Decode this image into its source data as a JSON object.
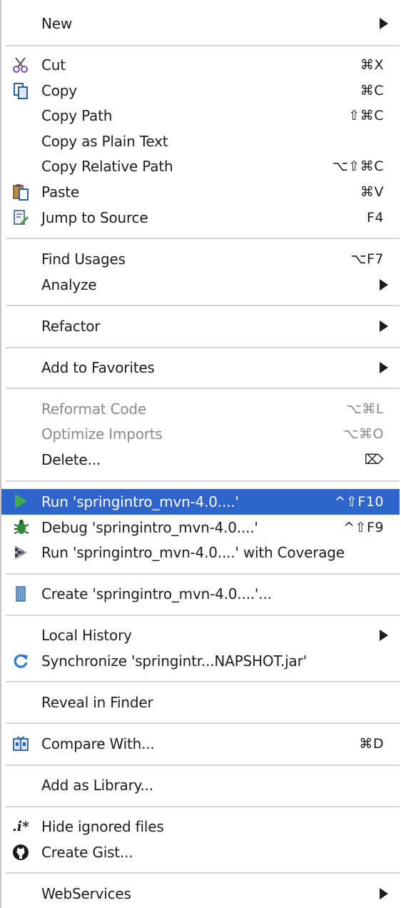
{
  "menu": {
    "new": {
      "label": "New"
    },
    "cut": {
      "label": "Cut",
      "shortcut": "⌘X"
    },
    "copy": {
      "label": "Copy",
      "shortcut": "⌘C"
    },
    "copy_path": {
      "label": "Copy Path",
      "shortcut": "⇧⌘C"
    },
    "copy_plain": {
      "label": "Copy as Plain Text"
    },
    "copy_relative": {
      "label": "Copy Relative Path",
      "shortcut": "⌥⇧⌘C"
    },
    "paste": {
      "label": "Paste",
      "shortcut": "⌘V"
    },
    "jump_source": {
      "label": "Jump to Source",
      "shortcut": "F4"
    },
    "find_usages": {
      "label": "Find Usages",
      "shortcut": "⌥F7"
    },
    "analyze": {
      "label": "Analyze"
    },
    "refactor": {
      "label": "Refactor"
    },
    "add_favorites": {
      "label": "Add to Favorites"
    },
    "reformat": {
      "label": "Reformat Code",
      "shortcut": "⌥⌘L"
    },
    "optimize": {
      "label": "Optimize Imports",
      "shortcut": "⌥⌘O"
    },
    "delete": {
      "label": "Delete...",
      "shortcut": "⌦"
    },
    "run": {
      "label": "Run 'springintro_mvn-4.0....'",
      "shortcut": "^⇧F10"
    },
    "debug": {
      "label": "Debug 'springintro_mvn-4.0....'",
      "shortcut": "^⇧F9"
    },
    "run_coverage": {
      "label": "Run 'springintro_mvn-4.0....' with Coverage"
    },
    "create": {
      "label": "Create 'springintro_mvn-4.0....'..."
    },
    "local_history": {
      "label": "Local History"
    },
    "synchronize": {
      "label": "Synchronize 'springintr...NAPSHOT.jar'"
    },
    "reveal": {
      "label": "Reveal in Finder"
    },
    "compare": {
      "label": "Compare With...",
      "shortcut": "⌘D"
    },
    "add_library": {
      "label": "Add as Library..."
    },
    "hide_ignored": {
      "label": "Hide ignored files",
      "icon_text": ".i*"
    },
    "create_gist": {
      "label": "Create Gist..."
    },
    "webservices": {
      "label": "WebServices"
    }
  },
  "colors": {
    "selection": "#2f65ca",
    "disabled_text": "#8a8a8a",
    "separator": "#d6d6d6"
  }
}
